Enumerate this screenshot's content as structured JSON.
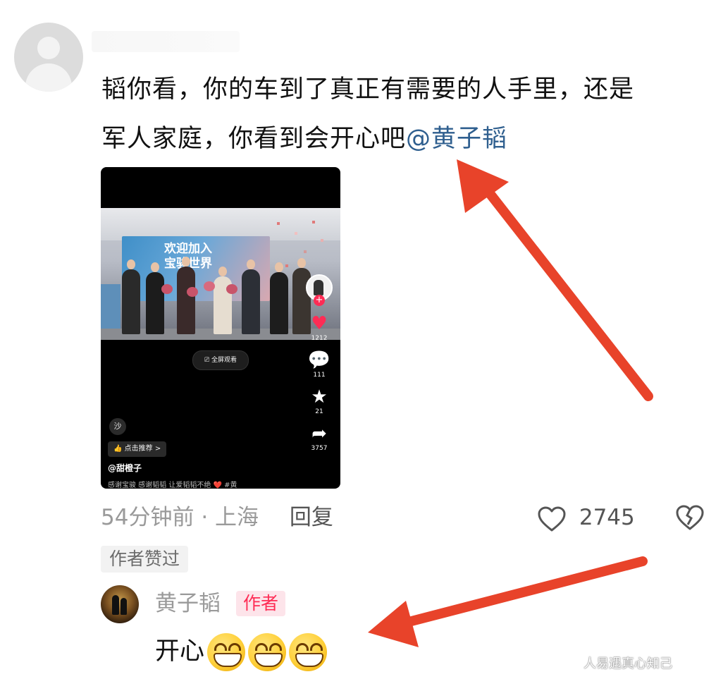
{
  "comment": {
    "line1": "韬你看，你的车到了真正有需要的人手里，还是",
    "line2_plain": "军人家庭，你看到会开心吧",
    "mention": "@黄子韬"
  },
  "video": {
    "banner_line1": "欢迎加入",
    "banner_line2": "宝骏世界",
    "fullscreen_label": "全屏观看",
    "like_count": "1212",
    "comment_count": "111",
    "favorite_count": "21",
    "share_count": "3757",
    "sound_label": "沙",
    "recommend_label": "点击推荐 >",
    "author": "@甜橙子",
    "caption": "感谢宝骏  感谢韬韬  让爱韬韬不绝 ❤️ #黄"
  },
  "meta": {
    "time": "54分钟前",
    "separator": "·",
    "location": "上海",
    "reply_label": "回复",
    "like_count": "2745"
  },
  "author_liked": "作者赞过",
  "reply": {
    "name": "黄子韬",
    "tag": "作者",
    "text": "开心"
  },
  "watermark": "人易遇真心知己",
  "colors": {
    "mention": "#2f5f8f",
    "author_tag_text": "#fe2c55",
    "author_tag_bg": "#fde4ea",
    "arrow": "#e8432a"
  },
  "icons": [
    "heart-outline-icon",
    "broken-heart-icon",
    "grin-emoji-icon",
    "fullscreen-icon",
    "comment-bubble-icon",
    "star-icon",
    "share-arrow-icon",
    "thumbs-up-icon"
  ]
}
